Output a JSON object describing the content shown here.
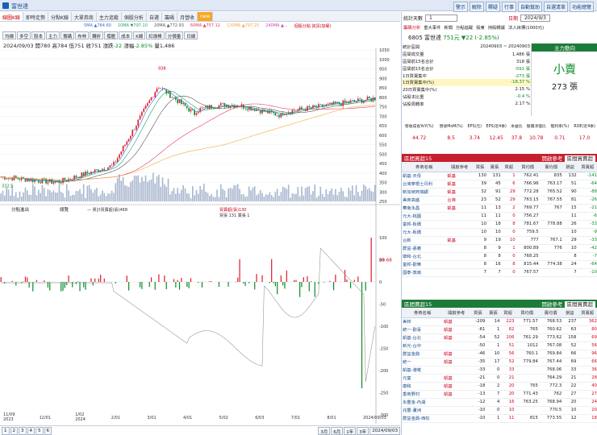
{
  "window": {
    "title": "富世達",
    "buttons": [
      "警示",
      "解除",
      "釋疑",
      "行事",
      "自動幫助",
      "自選清單",
      "功能總覽"
    ]
  },
  "tabs": [
    "線圖K線",
    "即時走勢",
    "分點K線",
    "大單券商",
    "主力追蹤",
    "個股分析",
    "自選",
    "籌碼",
    "月營收",
    "new"
  ],
  "ma_legend": [
    {
      "label": "5MA ▲784.60",
      "color": "#3b6fd4"
    },
    {
      "label": "10MA ▼797.10",
      "color": "#22a36b"
    },
    {
      "label": "20MA ▲772.93",
      "color": "#555555"
    },
    {
      "label": "60MA ▲757.12",
      "color": "#e33a5f"
    },
    {
      "label": "120MA ▲797.25",
      "color": "#f2a93b"
    },
    {
      "label": "240MA ▲…",
      "color": "#c04ab5"
    },
    {
      "label": "個股分點 資訊(加權)",
      "color": "#d0021b"
    }
  ],
  "toolbar": [
    "均線",
    "多空",
    "股本",
    "主力",
    "籌碼",
    "布林",
    "轉折",
    "撐壓",
    "成本",
    "K線",
    "紅綠棒",
    "分價量",
    "日線"
  ],
  "quote": {
    "date": "2024/09/03",
    "open_label": "開",
    "open": "780",
    "high_label": "高",
    "high": "784",
    "low_label": "低",
    "low": "751",
    "close_label": "收",
    "close": "751",
    "change_label": "漲跌",
    "change": "-22",
    "pct_label": "漲幅",
    "pct": "-2.85%",
    "vol_label": "量",
    "vol": "1,486"
  },
  "price_axis": [
    "1050",
    "1000",
    "950",
    "900",
    "850",
    "800",
    "750",
    "700",
    "650",
    "600",
    "550",
    "500",
    "450",
    "400",
    "350",
    "300",
    "250"
  ],
  "price_marks": {
    "high_label": "938",
    "low_label": "332.5"
  },
  "sub_chart": {
    "select_label": "分點進出",
    "btn_label": "總覽",
    "legend_a": "— 累計買賣超(張)468",
    "legend_b_title": "買賣超(張)130",
    "legend_b_sub": "買張 131 賣張 1",
    "axis": [
      "100",
      "50",
      "0",
      "-50",
      "-100",
      "-150",
      "-200",
      "-250",
      "-300",
      "-350"
    ],
    "marker": "49.68"
  },
  "date_axis": [
    "11/09\n2023",
    "12/01",
    "1/02\n2024",
    "2/01",
    "3/01",
    "4/01",
    "5/02",
    "6/03",
    "7/01",
    "8/01",
    "2024/09/03"
  ],
  "bottom_bar": {
    "pages": [
      "1",
      "2",
      "3",
      "4",
      "5",
      "6"
    ],
    "ranges": [
      "3月",
      "6月",
      "1年",
      "3年"
    ],
    "end_date": "2024/09/03"
  },
  "right": {
    "stat_days_label": "統計天數",
    "stat_days_value": "1",
    "range_btn": "日期",
    "date_value": "2024/9/3",
    "tabs": [
      "籌碼分析",
      "重大事件",
      "新聞",
      "分點追蹤",
      "股東",
      "持股轉讓",
      "法人目標(1000元)"
    ],
    "stock": "6805 富世達",
    "price": "751元",
    "change": "▼22 (-2.85%)",
    "period_label": "統計區間",
    "period": "20240903 ~ 20240903",
    "stats": [
      {
        "label": "區間成交量",
        "value": "1,486 張"
      },
      {
        "label": "區間前15名合計",
        "value": "318 張"
      },
      {
        "label": "區間前15名合計",
        "value": "-591 張"
      },
      {
        "label": "1日買賣集中",
        "value": "-273 張"
      },
      {
        "label": "1日買賣集中(%)",
        "value": "-18.37 %"
      },
      {
        "label": "20日買賣集中(%)",
        "value": "2.15 %"
      },
      {
        "label": "佔股本比重",
        "value": "-0.4 %"
      },
      {
        "label": "佔股周轉率",
        "value": "2.17 %"
      }
    ],
    "main_force_label": "主力動向",
    "main_force_status": "小賣",
    "main_force_value": "273 張",
    "metrics_header": [
      "營收成長YoY(%)",
      "營收MoM(%)",
      "EPS(元)",
      "EPS(近4季)",
      "本益比",
      "股價淨值比",
      "殖利率(%)",
      "ROE(近4季)"
    ],
    "metrics_values": [
      "44.72",
      "8.5",
      "3.74",
      "12.45",
      "37.8",
      "10.78",
      "0.71",
      "17.0"
    ],
    "buy_title": "區間買超15",
    "sell_title": "區間賣超15",
    "filter_label": "開啟參考",
    "filter_value": "區間買賣超",
    "cols": [
      "券商名稱",
      "開啟參考",
      "買張",
      "賣張",
      "買超",
      "買均價",
      "賣均價",
      "損益",
      "買賣超"
    ],
    "buy_rows": [
      [
        "凱基-天母",
        "凱基",
        "130",
        "131",
        "1",
        "762.41",
        "835",
        "132",
        "-141"
      ],
      [
        "台灣摩根士丹利",
        "凱基",
        "39",
        "45",
        "6",
        "766.96",
        "763.17",
        "51",
        "-64"
      ],
      [
        "新加坡商瑞銀",
        "凱基",
        "32",
        "91",
        "29",
        "772.28",
        "765.52",
        "90",
        "-88"
      ],
      [
        "美商高盛",
        "台灣",
        "23",
        "52",
        "29",
        "763.15",
        "767.55",
        "81",
        "-26"
      ],
      [
        "華南永昌",
        "凱基",
        "11",
        "13",
        "2",
        "769.77",
        "767",
        "15",
        "-21"
      ],
      [
        "元大-桃園",
        "",
        "11",
        "11",
        "0",
        "756.27",
        "",
        "11",
        "-6"
      ],
      [
        "富邦-板橋",
        "",
        "10",
        "18",
        "8",
        "781.67",
        "778.88",
        "26",
        "-33"
      ],
      [
        "元大-板橋",
        "",
        "10",
        "10",
        "0",
        "759.5",
        "",
        "10",
        "-9"
      ],
      [
        "台新",
        "凱基",
        "9",
        "19",
        "10",
        "777",
        "767.1",
        "29",
        "-33"
      ],
      [
        "群益-嘉義",
        "",
        "8",
        "9",
        "1",
        "800.89",
        "776",
        "10",
        "-42"
      ],
      [
        "康和-台北",
        "",
        "8",
        "8",
        "0",
        "768.25",
        "",
        "8",
        "-7"
      ],
      [
        "富邦-歡樂",
        "",
        "8",
        "16",
        "8",
        "815.44",
        "774.38",
        "24",
        "-64"
      ],
      [
        "國泰-敦南",
        "",
        "7",
        "7",
        "0",
        "767.57",
        "",
        "7",
        "-10"
      ]
    ],
    "sell_rows": [
      [
        "美林",
        "凱基",
        "-209",
        "14",
        "223",
        "771.57",
        "768.53",
        "237",
        "362"
      ],
      [
        "統一-歡喜",
        "凱基",
        "-61",
        "1",
        "62",
        "765",
        "760.62",
        "63",
        "80"
      ],
      [
        "凱基-台北",
        "凱基",
        "-54",
        "52",
        "106",
        "761.29",
        "773.62",
        "158",
        "69"
      ],
      [
        "新光-台中",
        "",
        "-50",
        "1",
        "51",
        "1012",
        "767.08",
        "52",
        "56"
      ],
      [
        "群益金鼎",
        "凱基",
        "-46",
        "10",
        "56",
        "760.1",
        "769.84",
        "66",
        "96"
      ],
      [
        "統一",
        "凱基",
        "-35",
        "17",
        "52",
        "779.84",
        "767.44",
        "69",
        "66"
      ],
      [
        "凱基-港墘",
        "",
        "-33",
        "0",
        "33",
        "",
        "768.06",
        "33",
        "36"
      ],
      [
        "元富",
        "凱基",
        "-21",
        "0",
        "21",
        "",
        "764.29",
        "21",
        "28"
      ],
      [
        "康和",
        "凱基",
        "-18",
        "2",
        "20",
        "765",
        "772.3",
        "22",
        "40"
      ],
      [
        "香商野村",
        "凱基",
        "-13",
        "7",
        "20",
        "771.43",
        "762",
        "27",
        "27"
      ],
      [
        "永豐金-內湖",
        "",
        "-12",
        "4",
        "16",
        "763.25",
        "768.94",
        "20",
        "24"
      ],
      [
        "兆豐-蘆洲",
        "",
        "-10",
        "0",
        "10",
        "",
        "770.5",
        "10",
        "20"
      ],
      [
        "群益金鼎-西松",
        "",
        "-10",
        "1",
        "11",
        "815",
        "773.55",
        "12",
        "18"
      ]
    ]
  }
}
